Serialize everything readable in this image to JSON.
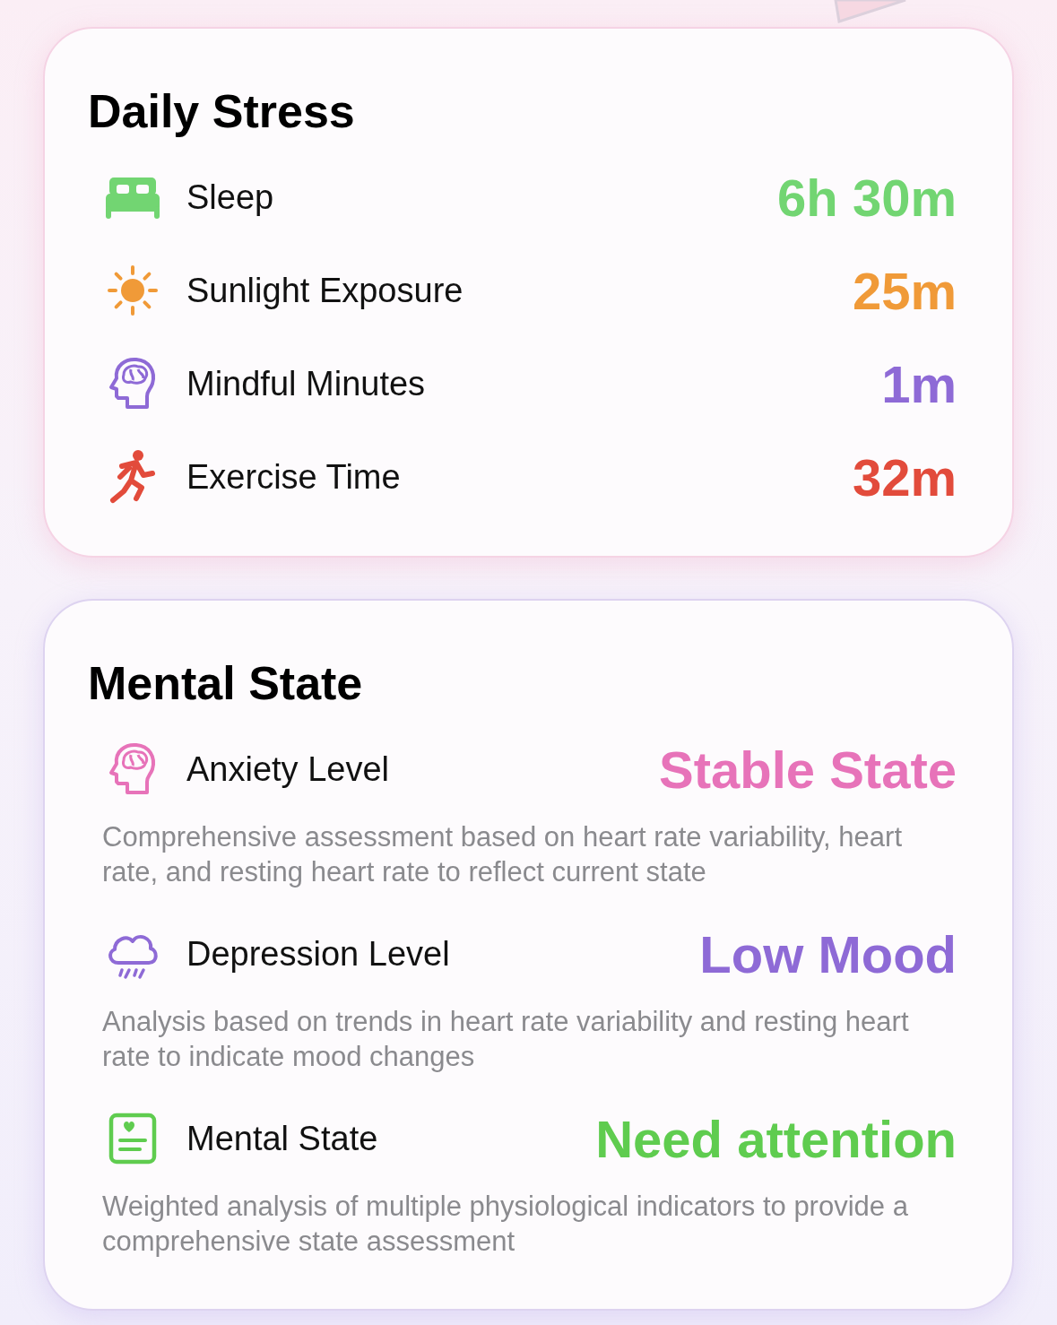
{
  "daily_stress": {
    "title": "Daily Stress",
    "items": [
      {
        "kind": "bed",
        "label": "Sleep",
        "value": "6h 30m",
        "color": "#72d572"
      },
      {
        "kind": "sun",
        "label": "Sunlight Exposure",
        "value": "25m",
        "color": "#f09a38"
      },
      {
        "kind": "brain",
        "label": "Mindful Minutes",
        "value": "1m",
        "color": "#8e6ad6"
      },
      {
        "kind": "runner",
        "label": "Exercise Time",
        "value": "32m",
        "color": "#e24b3b"
      }
    ]
  },
  "mental_state": {
    "title": "Mental State",
    "items": [
      {
        "kind": "brain",
        "label": "Anxiety Level",
        "value": "Stable State",
        "color": "#e773b9",
        "description": "Comprehensive assessment based on heart rate variability, heart rate, and resting heart rate to reflect current state"
      },
      {
        "kind": "rain",
        "label": "Depression Level",
        "value": "Low Mood",
        "color": "#8e6ad6",
        "description": "Analysis based on trends in heart rate variability and resting heart rate to indicate mood changes"
      },
      {
        "kind": "report",
        "label": "Mental State",
        "value": "Need attention",
        "color": "#5fcc4f",
        "description": "Weighted analysis of multiple physiological indicators to provide a comprehensive state assessment"
      }
    ]
  }
}
